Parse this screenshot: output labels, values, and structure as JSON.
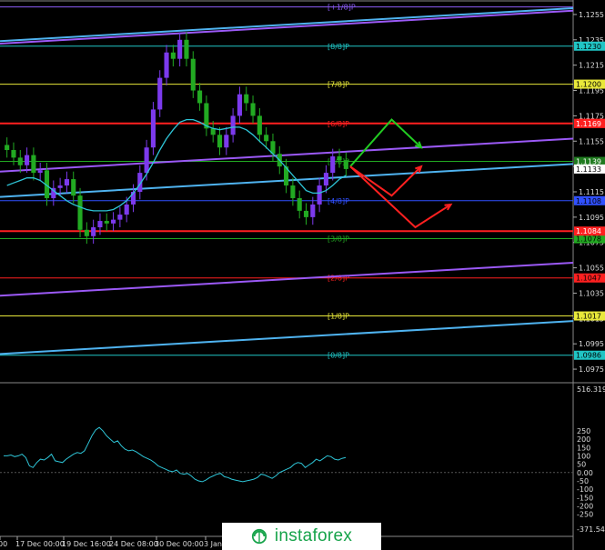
{
  "chart_data": [
    {
      "type": "line",
      "title": "",
      "price_axis": {
        "range": [
          1.0965,
          1.1265
        ],
        "ticks": [
          "1.1255",
          "1.1235",
          "1.1215",
          "1.1195",
          "1.1175",
          "1.1155",
          "1.1135",
          "1.1115",
          "1.1095",
          "1.1075",
          "1.1055",
          "1.1035",
          "1.1015",
          "1.0995",
          "1.0975"
        ]
      },
      "murrey_levels": [
        {
          "label": "[+1/8]P",
          "value": 1.1261,
          "color": "#8b5cf6",
          "tag": ""
        },
        {
          "label": "[8/8]P",
          "value": 1.123,
          "color": "#20c5c5",
          "tag": "1.1230"
        },
        {
          "label": "[7/8]P",
          "value": 1.12,
          "color": "#e8e83a",
          "tag": "1.1200"
        },
        {
          "label": "[6/8]P",
          "value": 1.1169,
          "color": "#ff2020",
          "tag": "1.1169"
        },
        {
          "label": "[5/8]P",
          "value": 1.1139,
          "color": "#22aa22",
          "tag": ""
        },
        {
          "label": "[4/8]P",
          "value": 1.1108,
          "color": "#3050ff",
          "tag": "1.1108"
        },
        {
          "label": "[3/8]P",
          "value": 1.1078,
          "color": "#22aa22",
          "tag": "1.1078"
        },
        {
          "label": "[2/8]P",
          "value": 1.1047,
          "color": "#ff2020",
          "tag": "1.1047"
        },
        {
          "label": "[1/8]P",
          "value": 1.1017,
          "color": "#e8e83a",
          "tag": "1.1017"
        },
        {
          "label": "[0/8]P",
          "value": 1.0986,
          "color": "#20c5c5",
          "tag": "1.0986"
        }
      ],
      "horizontal_lines": [
        {
          "value": 1.1169,
          "color": "#ff2020",
          "tag": "1.1169"
        },
        {
          "value": 1.1084,
          "color": "#ff2020",
          "tag": "1.1084"
        }
      ],
      "price_tags": [
        {
          "value": 1.1139,
          "text": "1.1139",
          "bg": "#1f7a1f"
        },
        {
          "value": 1.1133,
          "text": "1.1133",
          "bg": "#ffffff"
        }
      ],
      "channels": [
        {
          "color": "#9b59f6",
          "points": [
            [
              0,
              1.1232
            ],
            [
              185,
              1.1258
            ]
          ]
        },
        {
          "color": "#4fb3f0",
          "points": [
            [
              0,
              1.1234
            ],
            [
              185,
              1.126
            ]
          ]
        },
        {
          "color": "#9b59f6",
          "points": [
            [
              0,
              1.1131
            ],
            [
              185,
              1.1157
            ]
          ]
        },
        {
          "color": "#4fb3f0",
          "points": [
            [
              0,
              1.1111
            ],
            [
              185,
              1.1137
            ]
          ]
        },
        {
          "color": "#9b59f6",
          "points": [
            [
              0,
              1.1033
            ],
            [
              185,
              1.1059
            ]
          ]
        },
        {
          "color": "#4fb3f0",
          "points": [
            [
              0,
              1.0987
            ],
            [
              185,
              1.1013
            ]
          ]
        }
      ],
      "candles_close": [
        1.1148,
        1.1142,
        1.1136,
        1.1144,
        1.113,
        1.1132,
        1.111,
        1.1118,
        1.112,
        1.1125,
        1.1112,
        1.1085,
        1.108,
        1.1087,
        1.1092,
        1.109,
        1.1093,
        1.1097,
        1.1105,
        1.1115,
        1.113,
        1.115,
        1.118,
        1.1205,
        1.1225,
        1.122,
        1.1235,
        1.122,
        1.1195,
        1.1185,
        1.1165,
        1.116,
        1.115,
        1.116,
        1.1175,
        1.1192,
        1.1185,
        1.1175,
        1.116,
        1.1155,
        1.1145,
        1.1135,
        1.112,
        1.111,
        1.11,
        1.1095,
        1.1105,
        1.112,
        1.113,
        1.1143,
        1.114,
        1.1133
      ],
      "candles_bull": [
        false,
        false,
        false,
        true,
        false,
        true,
        false,
        true,
        true,
        true,
        false,
        false,
        false,
        true,
        true,
        false,
        true,
        true,
        true,
        true,
        true,
        true,
        true,
        true,
        true,
        false,
        true,
        false,
        false,
        false,
        false,
        false,
        false,
        true,
        true,
        true,
        false,
        false,
        false,
        false,
        false,
        false,
        false,
        false,
        false,
        false,
        true,
        true,
        true,
        true,
        false,
        false
      ],
      "moving_average": [
        1.112,
        1.1122,
        1.1124,
        1.1126,
        1.1126,
        1.1124,
        1.112,
        1.1116,
        1.1112,
        1.1108,
        1.1105,
        1.1103,
        1.1101,
        1.11,
        1.11,
        1.11,
        1.1101,
        1.1104,
        1.1108,
        1.1114,
        1.1121,
        1.1129,
        1.1138,
        1.1148,
        1.1157,
        1.1164,
        1.117,
        1.1172,
        1.1172,
        1.117,
        1.1167,
        1.1165,
        1.1164,
        1.1165,
        1.1166,
        1.1166,
        1.1164,
        1.116,
        1.1155,
        1.115,
        1.1145,
        1.114,
        1.1134,
        1.1128,
        1.1122,
        1.1116,
        1.1114,
        1.1114,
        1.1116,
        1.112,
        1.1125,
        1.1128
      ],
      "forecast_arrows": [
        {
          "color": "#22cc22",
          "points": [
            [
              0,
              1.1135
            ],
            [
              7,
              1.1172
            ],
            [
              12,
              1.115
            ]
          ]
        },
        {
          "color": "#ff2020",
          "points": [
            [
              0,
              1.1135
            ],
            [
              7,
              1.1112
            ],
            [
              12,
              1.1135
            ]
          ]
        },
        {
          "color": "#ff2020",
          "points": [
            [
              0,
              1.1135
            ],
            [
              11,
              1.1087
            ],
            [
              17,
              1.1105
            ]
          ]
        }
      ]
    },
    {
      "type": "line",
      "title": "",
      "indicator_axis": {
        "max_label": "516.3192",
        "min_label": "-371.549",
        "range": [
          -371.549,
          516.3192
        ],
        "ticks": [
          "250",
          "200",
          "150",
          "100",
          "50",
          "0.00",
          "-50",
          "-100",
          "-150",
          "-200",
          "-250"
        ]
      },
      "values": [
        100,
        100,
        105,
        95,
        100,
        110,
        90,
        40,
        30,
        60,
        80,
        75,
        90,
        110,
        70,
        65,
        60,
        80,
        95,
        110,
        120,
        115,
        130,
        175,
        220,
        255,
        270,
        250,
        220,
        200,
        180,
        190,
        160,
        140,
        130,
        135,
        125,
        110,
        95,
        85,
        75,
        60,
        40,
        30,
        20,
        10,
        5,
        15,
        -5,
        -10,
        -5,
        -20,
        -40,
        -50,
        -55,
        -45,
        -30,
        -20,
        -10,
        -5,
        -25,
        -30,
        -40,
        -45,
        -50,
        -55,
        -50,
        -45,
        -40,
        -30,
        -10,
        -15,
        -25,
        -35,
        -20,
        0,
        10,
        20,
        30,
        50,
        60,
        55,
        30,
        45,
        60,
        80,
        70,
        85,
        100,
        95,
        80,
        75,
        85,
        90
      ],
      "reference_lines": [
        0
      ]
    }
  ],
  "time_axis": {
    "labels": [
      "00",
      "17 Dec 00:00",
      "19 Dec 16:00",
      "24 Dec 08:00",
      "30 Dec 00:00",
      "3 Jan"
    ]
  },
  "logo": {
    "text": "instaforex"
  },
  "colors": {
    "background": "#000000",
    "candle_bull": "#7c3aed",
    "candle_bear": "#22aa22",
    "moving_average": "#2ec4d6",
    "indicator": "#2ec4d6"
  }
}
